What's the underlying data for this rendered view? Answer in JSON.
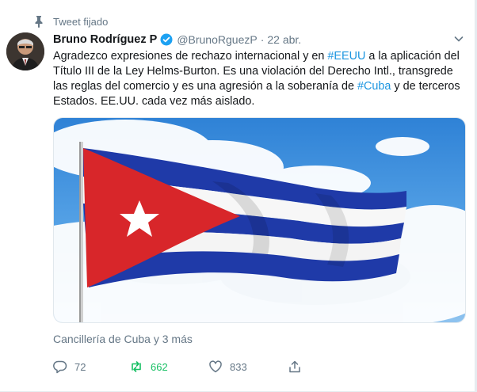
{
  "pinned": {
    "label": "Tweet fijado"
  },
  "author": {
    "display_name": "Bruno Rodríguez P",
    "username": "@BrunoRguezP",
    "separator": "·",
    "timestamp": "22 abr."
  },
  "tweet": {
    "segments": [
      {
        "text": "Agradezco expresiones de rechazo internacional y en ",
        "hashtag": false
      },
      {
        "text": "#EEUU",
        "hashtag": true
      },
      {
        "text": " a la aplicación del Título III de la Ley Helms-Burton. Es una violación del Derecho Intl., transgrede las reglas del comercio y es una agresión a la soberanía de ",
        "hashtag": false
      },
      {
        "text": "#Cuba",
        "hashtag": true
      },
      {
        "text": " y de terceros Estados. EE.UU. cada vez más aislado.",
        "hashtag": false
      }
    ]
  },
  "media_credit": "Cancillería de Cuba y 3 más",
  "actions": {
    "reply_count": "72",
    "retweet_count": "662",
    "like_count": "833"
  },
  "colors": {
    "link": "#1b95e0",
    "retweet_active": "#17bf63",
    "secondary_text": "#657786",
    "flag_blue": "#1f3aa8",
    "flag_red": "#d8262a"
  },
  "icons": {
    "pin": "pin-icon",
    "verified": "verified-badge-icon",
    "caret": "chevron-down-icon",
    "reply": "reply-icon",
    "retweet": "retweet-icon",
    "like": "heart-icon",
    "share": "share-icon"
  }
}
